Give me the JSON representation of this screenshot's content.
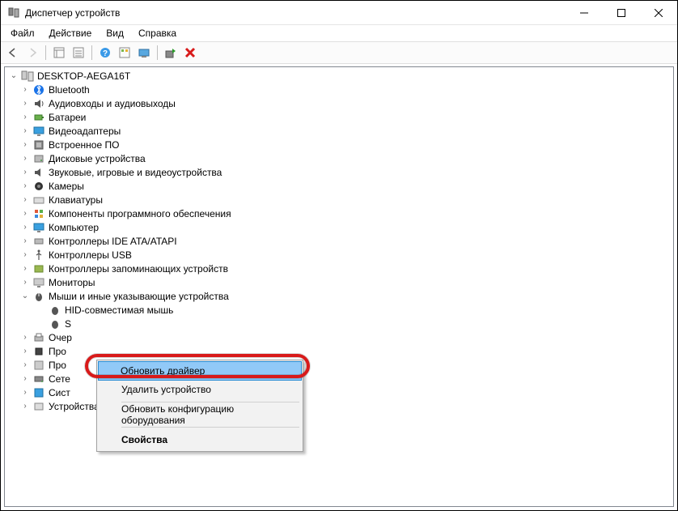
{
  "window": {
    "title": "Диспетчер устройств"
  },
  "menu": {
    "file": "Файл",
    "action": "Действие",
    "view": "Вид",
    "help": "Справка"
  },
  "tree": {
    "root": "DESKTOP-AEGA16T",
    "items": [
      "Bluetooth",
      "Аудиовходы и аудиовыходы",
      "Батареи",
      "Видеоадаптеры",
      "Встроенное ПО",
      "Дисковые устройства",
      "Звуковые, игровые и видеоустройства",
      "Камеры",
      "Клавиатуры",
      "Компоненты программного обеспечения",
      "Компьютер",
      "Контроллеры IDE ATA/ATAPI",
      "Контроллеры USB",
      "Контроллеры запоминающих устройств",
      "Мониторы",
      "Мыши и иные указывающие устройства"
    ],
    "mouse_children": [
      "HID-совместимая мышь",
      "S"
    ],
    "rest": [
      "Очер",
      "Про",
      "Про",
      "Сете",
      "Сист",
      "Устройства HID (Human Interface Devices)"
    ]
  },
  "context_menu": {
    "update": "Обновить драйвер",
    "remove": "Удалить устройство",
    "scan": "Обновить конфигурацию оборудования",
    "properties": "Свойства"
  }
}
